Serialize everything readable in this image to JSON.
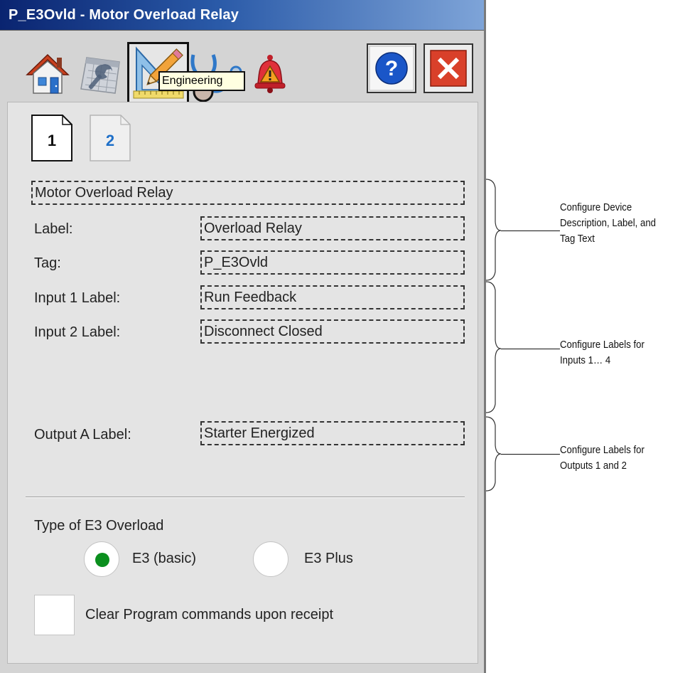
{
  "window": {
    "title": "P_E3Ovld - Motor Overload Relay"
  },
  "toolbar": {
    "buttons": [
      {
        "name": "home-icon",
        "tooltip": ""
      },
      {
        "name": "maintenance-icon",
        "tooltip": ""
      },
      {
        "name": "engineering-icon",
        "tooltip": "Engineering",
        "selected": true
      },
      {
        "name": "diagnostics-icon",
        "tooltip": ""
      },
      {
        "name": "alarms-icon",
        "tooltip": ""
      },
      {
        "name": "help-icon",
        "tooltip": ""
      },
      {
        "name": "close-icon",
        "tooltip": ""
      }
    ],
    "active_tooltip": "Engineering"
  },
  "pages": {
    "page1": "1",
    "page2": "2",
    "selected": "1"
  },
  "config": {
    "description": "Motor Overload Relay",
    "label_caption": "Label:",
    "label_value": "Overload Relay",
    "tag_caption": "Tag:",
    "tag_value": "P_E3Ovld",
    "input1_caption": "Input 1 Label:",
    "input1_value": "Run Feedback",
    "input2_caption": "Input 2 Label:",
    "input2_value": "Disconnect Closed",
    "outputA_caption": "Output A Label:",
    "outputA_value": "Starter Energized"
  },
  "overload_type": {
    "heading": "Type of E3 Overload",
    "options": [
      "E3 (basic)",
      "E3 Plus"
    ],
    "selected": "E3 (basic)"
  },
  "clear_commands": {
    "label": "Clear Program commands upon receipt",
    "checked": false
  },
  "annotations": {
    "a1": [
      "Configure Device",
      "Description, Label, and",
      "Tag Text"
    ],
    "a2": [
      "Configure Labels for",
      "Inputs 1… 4"
    ],
    "a3": [
      "Configure Labels for",
      "Outputs 1 and 2"
    ]
  },
  "colors": {
    "title_gradient_start": "#0a2470",
    "title_gradient_end": "#7ea4d8",
    "panel_bg": "#e4e4e4",
    "radio_selected": "#0b8f1e",
    "close_button": "#d9402a",
    "help_button": "#1a56c8"
  }
}
